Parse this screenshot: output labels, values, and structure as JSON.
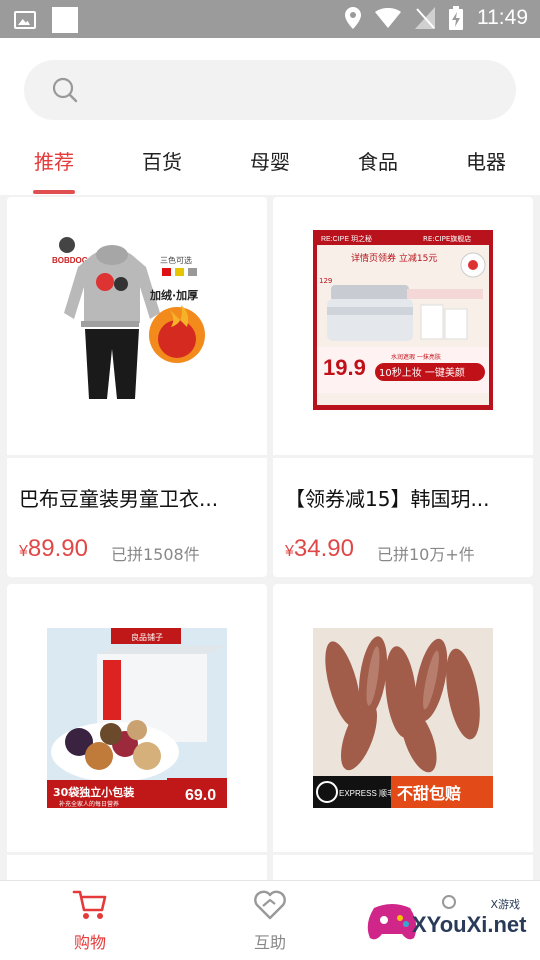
{
  "status_bar": {
    "time": "11:49"
  },
  "search": {
    "placeholder": ""
  },
  "tabs": [
    {
      "label": "推荐",
      "active": true
    },
    {
      "label": "百货",
      "active": false
    },
    {
      "label": "母婴",
      "active": false
    },
    {
      "label": "食品",
      "active": false
    },
    {
      "label": "电器",
      "active": false
    }
  ],
  "products": [
    {
      "title": "巴布豆童装男童卫衣...",
      "price": "89.90",
      "currency": "¥",
      "sold": "已拼1508件",
      "image_text": {
        "brand": "BOBDOG",
        "colors": "三色可选",
        "feature": "加绒·加厚"
      }
    },
    {
      "title": "【领券减15】韩国玥...",
      "price": "34.90",
      "currency": "¥",
      "sold": "已拼10万+件",
      "image_text": {
        "brand": "RE:CIPE 玥之秘",
        "store": "RE:CIPE旗舰店",
        "coupon": "详情页领券 立减15元",
        "old_price": "129",
        "price": "19.9",
        "slogan": "10秒上妆 一键美颜",
        "sub": "水润遮瑕 一抹亮肤"
      }
    },
    {
      "title": "",
      "price": "",
      "sold": "",
      "image_text": {
        "brand": "良品铺子",
        "banner": "30袋独立小包装",
        "sub": "补充全家人的每日营养",
        "price": "69.0"
      }
    },
    {
      "title": "",
      "price": "",
      "sold": "",
      "image_text": {
        "express": "EXPRESS 顺丰速运",
        "promise": "不甜包赔"
      }
    }
  ],
  "bottom_nav": [
    {
      "label": "购物",
      "active": true
    },
    {
      "label": "互助",
      "active": false
    }
  ],
  "watermark": {
    "text": "XYouXi.net",
    "small": "X游戏"
  },
  "colors": {
    "accent": "#e53a3a",
    "status_bar": "#9b9b9b"
  }
}
